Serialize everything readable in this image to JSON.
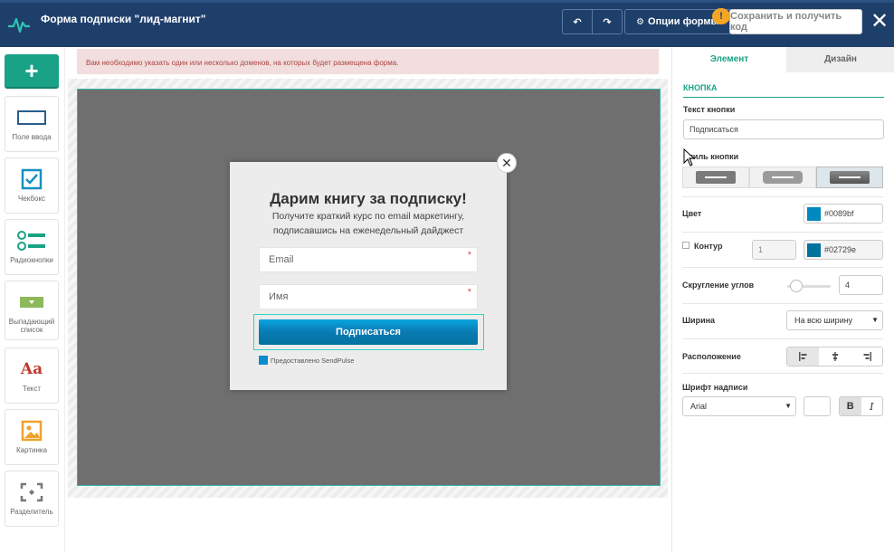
{
  "header": {
    "title": "Форма подписки \"лид-магнит\"",
    "options_label": "Опции формы",
    "save_label": "Сохранить и получить код",
    "close_glyph": "✕",
    "undo_glyph": "↶",
    "redo_glyph": "↷",
    "warning_glyph": "!"
  },
  "sidebar": {
    "add_glyph": "+",
    "tools": [
      {
        "label": "Поле ввода",
        "icon": "input-field-icon"
      },
      {
        "label": "Чекбокс",
        "icon": "checkbox-icon"
      },
      {
        "label": "Радиокнопки",
        "icon": "radio-buttons-icon"
      },
      {
        "label": "Выпадающий список",
        "icon": "dropdown-icon"
      },
      {
        "label": "Текст",
        "icon": "text-icon",
        "glyph": "Aa"
      },
      {
        "label": "Картинка",
        "icon": "image-icon"
      },
      {
        "label": "Разделитель",
        "icon": "divider-icon"
      }
    ]
  },
  "alert": {
    "text": "Вам необходимо указать один или несколько доменов, на которых будет размещена форма."
  },
  "popup": {
    "title": "Дарим книгу за подписку!",
    "subtitle_line1": "Получите краткий курс по email маркетингу,",
    "subtitle_line2": "подписавшись на еженедельный дайджест",
    "email_placeholder": "Email",
    "name_placeholder": "Имя",
    "required_mark": "*",
    "button_label": "Подписаться",
    "powered_by": "Предоставлено SendPulse",
    "close_glyph": "✕"
  },
  "panel": {
    "tabs": [
      "Элемент",
      "Дизайн"
    ],
    "section_title": "КНОПКА",
    "button_text_label": "Текст кнопки",
    "button_text_value": "Подписаться",
    "button_style_label": "Стиль кнопки",
    "color_label": "Цвет",
    "color_value": "#0089bf",
    "outline_label": "Контур",
    "outline_width": "1",
    "outline_color": "#02729e",
    "radius_label": "Скругление углов",
    "radius_value": "4",
    "width_label": "Ширина",
    "width_value": "На всю ширину",
    "position_label": "Расположение",
    "font_label": "Шрифт надписи",
    "font_value": "Arial",
    "bold_glyph": "B",
    "italic_glyph": "I"
  },
  "colors": {
    "accent": "#1aa287",
    "header_bg": "#1f3f6b",
    "button_color": "#0089bf",
    "outline_color": "#02729e"
  }
}
